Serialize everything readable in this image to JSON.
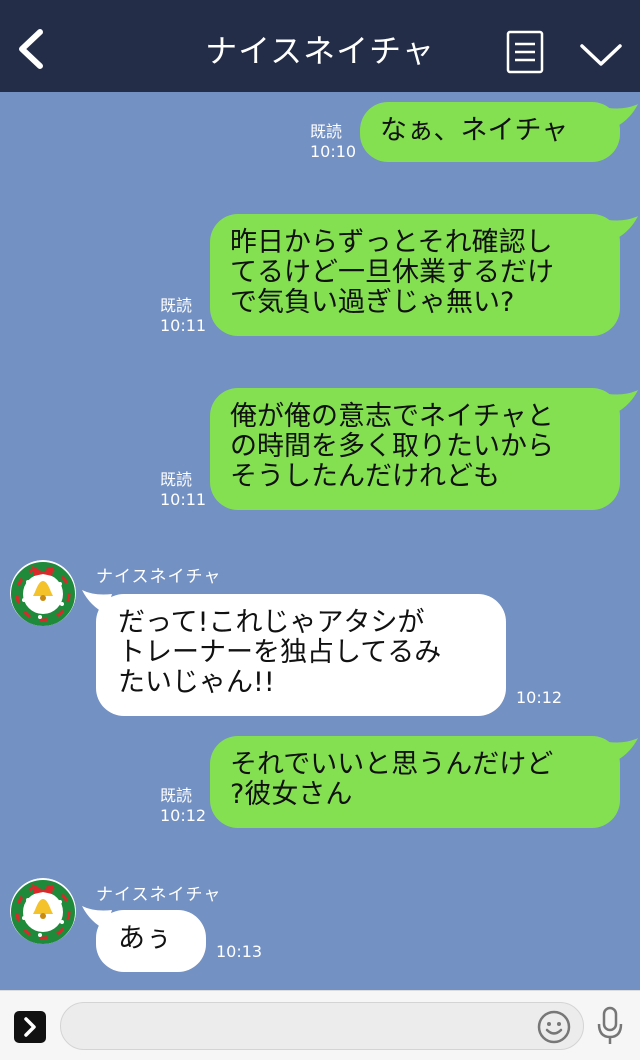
{
  "header": {
    "title": "ナイスネイチャ"
  },
  "messages": [
    {
      "from": "me",
      "text": "なぁ、ネイチャ",
      "read": "既読",
      "time": "10:10"
    },
    {
      "from": "me",
      "text": "昨日からずっとそれ確認し\nてるけど一旦休業するだけ\nで気負い過ぎじゃ無い?",
      "read": "既読",
      "time": "10:11"
    },
    {
      "from": "me",
      "text": "俺が俺の意志でネイチャと\nの時間を多く取りたいから\nそうしたんだけれども",
      "read": "既読",
      "time": "10:11"
    },
    {
      "from": "them",
      "sender": "ナイスネイチャ",
      "text": "だって!これじゃアタシが\nトレーナーを独占してるみ\nたいじゃん!!",
      "time": "10:12"
    },
    {
      "from": "me",
      "text": "それでいいと思うんだけど\n?彼女さん",
      "read": "既読",
      "time": "10:12"
    },
    {
      "from": "them",
      "sender": "ナイスネイチャ",
      "text": "あぅ",
      "time": "10:13"
    }
  ],
  "colors": {
    "header_bg": "#232d47",
    "chat_bg": "#7391c2",
    "my_bubble": "#84e051",
    "their_bubble": "#ffffff"
  },
  "icons": {
    "back": "chevron-left-icon",
    "menu": "menu-icon",
    "collapse": "chevron-down-icon",
    "expand": "expand-icon",
    "emoji": "emoji-icon",
    "mic": "mic-icon",
    "avatar": "wreath-avatar"
  },
  "composer": {
    "placeholder": ""
  }
}
